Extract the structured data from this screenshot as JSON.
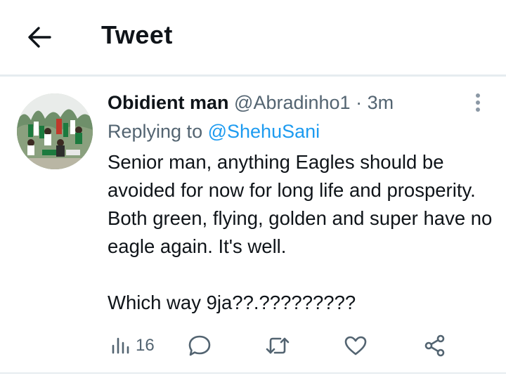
{
  "header": {
    "title": "Tweet",
    "back_icon": "arrow-left-icon"
  },
  "tweet": {
    "author_name": "Obidient man",
    "handle": "@Abradinho1",
    "separator": "·",
    "timestamp": "3m",
    "more_icon": "more-vertical-icon",
    "replying_prefix": "Replying to",
    "replying_to": "@ShehuSani",
    "text": "Senior man, anything Eagles should be avoided for now for long life and prosperity.  Both green, flying, golden and super have no eagle again. It's well.\n\nWhich way 9ja??.?????????",
    "avatar_icon": "profile-photo"
  },
  "actions": {
    "views_icon": "analytics-bars-icon",
    "views_count": "16",
    "reply_icon": "reply-bubble-icon",
    "retweet_icon": "retweet-icon",
    "like_icon": "heart-icon",
    "share_icon": "share-icon"
  },
  "colors": {
    "text": "#0f1419",
    "secondary": "#536471",
    "link": "#1d9bf0",
    "divider": "#e6ecf0"
  }
}
